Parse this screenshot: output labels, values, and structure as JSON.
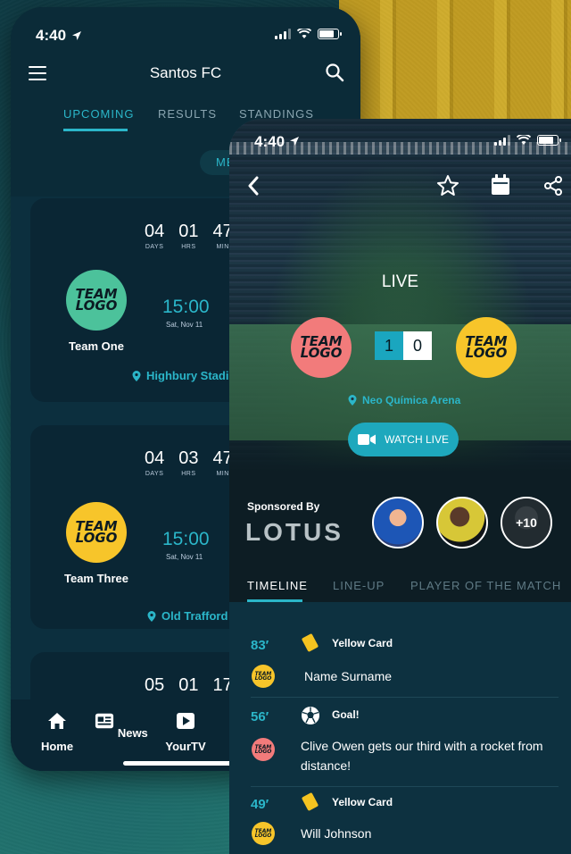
{
  "screen1": {
    "status_time": "4:40",
    "title": "Santos FC",
    "tabs": [
      {
        "label": "UPCOMING"
      },
      {
        "label": "RESULTS"
      },
      {
        "label": "STANDINGS"
      }
    ],
    "filter_pill": "ME",
    "matches": [
      {
        "countdown": {
          "days": "04",
          "days_label": "DAYS",
          "hrs": "01",
          "hrs_label": "HRS",
          "min": "47",
          "min_label": "MIN"
        },
        "team_name": "Team One",
        "team_logo_color": "#4cc29b",
        "kickoff": "15:00",
        "date": "Sat, Nov 11",
        "venue": "Highbury Stadiu"
      },
      {
        "countdown": {
          "days": "04",
          "days_label": "DAYS",
          "hrs": "03",
          "hrs_label": "HRS",
          "min": "47",
          "min_label": "MIN"
        },
        "team_name": "Team Three",
        "team_logo_color": "#f7c52a",
        "kickoff": "15:00",
        "date": "Sat, Nov 11",
        "venue": "Old Trafford"
      },
      {
        "countdown": {
          "days": "05",
          "hrs": "01",
          "min": "17"
        }
      }
    ],
    "tabbar": [
      {
        "label": "Home"
      },
      {
        "label": "News"
      },
      {
        "label": "YourTV"
      }
    ]
  },
  "logo_text": {
    "line1": "TEAM",
    "line2": "LOGO"
  },
  "screen2": {
    "status_time": "4:40",
    "live_label": "LIVE",
    "home_logo_color": "#f27b7b",
    "away_logo_color": "#f7c52a",
    "score_home": "1",
    "score_away": "0",
    "venue": "Neo Química Arena",
    "watch_label": "WATCH LIVE",
    "sponsored_by": "Sponsored By",
    "sponsor_name": "LOTUS",
    "more_count": "+10",
    "tabs": [
      {
        "label": "TIMELINE"
      },
      {
        "label": "LINE-UP"
      },
      {
        "label": "PLAYER OF THE MATCH"
      }
    ],
    "events": [
      {
        "minute": "83′",
        "type": "Yellow Card",
        "team_color": "#f7c52a",
        "description": "Name Surname"
      },
      {
        "minute": "56′",
        "type": "Goal!",
        "team_color": "#f27b7b",
        "description": "Clive Owen gets our third with a rocket from distance!"
      },
      {
        "minute": "49′",
        "type": "Yellow Card",
        "team_color": "#f7c52a",
        "description": "Will Johnson"
      }
    ]
  },
  "colors": {
    "accent": "#2bb6c9",
    "yellow_card": "#f5c320"
  },
  "icons": [
    "menu-icon",
    "search-icon",
    "location-pin-icon",
    "home-icon",
    "news-icon",
    "tv-play-icon",
    "back-chevron-icon",
    "star-icon",
    "calendar-icon",
    "share-icon",
    "video-camera-icon",
    "yellow-card-icon",
    "football-icon"
  ]
}
